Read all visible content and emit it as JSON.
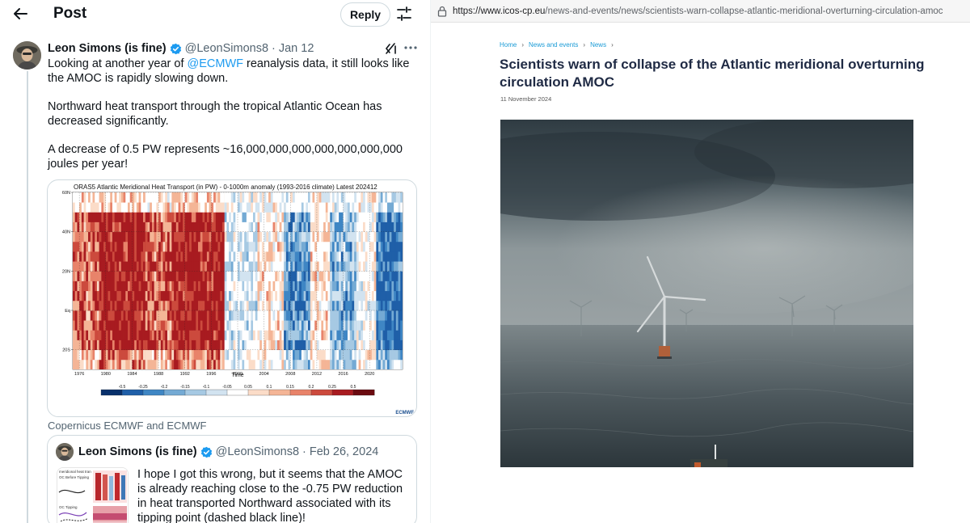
{
  "x_post": {
    "header": {
      "back_icon": "arrow-left-icon",
      "title": "Post",
      "reply_label": "Reply",
      "filter_icon": "sliders-icon"
    },
    "author": {
      "name": "Leon Simons (is fine)",
      "handle": "@LeonSimons8",
      "separator": "·",
      "date": "Jan 12"
    },
    "text": {
      "p1_before": "Looking at another year of ",
      "p1_mention": "@ECMWF",
      "p1_after": " reanalysis data, it still looks like the AMOC is rapidly slowing down.",
      "p2": "Northward heat transport through the tropical Atlantic Ocean has decreased significantly.",
      "p3": "A decrease of 0.5 PW represents ~16,000,000,000,000,000,000,000 joules per year!"
    },
    "attribution": "Copernicus ECMWF and ECMWF",
    "quote": {
      "name": "Leon Simons (is fine)",
      "handle": "@LeonSimons8",
      "separator": "·",
      "date": "Feb 26, 2024",
      "text": "I hope I got this wrong, but it seems that the AMOC is already reaching close to the -0.75 PW reduction in heat transported Northward associated with its tipping point (dashed black line)!",
      "thumb_labels": [
        "meridional heat tran",
        "OC Before Tipping",
        "OC Tipping"
      ]
    }
  },
  "chart_data": {
    "type": "heatmap",
    "title": "ORAS5 Atlantic Meridional Heat Transport (in PW) - 0-1000m anomaly (1993-2016 climate) Latest 202412",
    "xlabel": "Time",
    "ylabel": "",
    "x_ticks": [
      "1976",
      "1980",
      "1984",
      "1988",
      "1992",
      "1996",
      "2000",
      "2004",
      "2008",
      "2012",
      "2016",
      "2020"
    ],
    "y_ticks": [
      "60N",
      "40N",
      "20N",
      "Eq",
      "20S"
    ],
    "xlim": [
      1975,
      2025
    ],
    "ylim": [
      -30,
      60
    ],
    "colorbar_ticks": [
      "-0.5",
      "-0.25",
      "-0.2",
      "-0.15",
      "-0.1",
      "-0.05",
      "0.05",
      "0.1",
      "0.15",
      "0.2",
      "0.25",
      "0.5"
    ],
    "colorbar_colors": [
      "#08306b",
      "#1f5fa8",
      "#3f86c4",
      "#74aad4",
      "#a6c9e3",
      "#d2e3f0",
      "#ffffff",
      "#fbdcc8",
      "#f4b596",
      "#e8836a",
      "#cc4a3d",
      "#a81b20",
      "#6b0b10"
    ],
    "footer": "ECMWF",
    "periods": [
      {
        "from": 1975,
        "to": 1979,
        "value": 0.2
      },
      {
        "from": 1979,
        "to": 1986,
        "value": 0.3
      },
      {
        "from": 1986,
        "to": 1990,
        "value": 0.2
      },
      {
        "from": 1990,
        "to": 1998,
        "value": 0.3
      },
      {
        "from": 1998,
        "to": 2003,
        "value": -0.05
      },
      {
        "from": 2003,
        "to": 2007,
        "value": 0.05
      },
      {
        "from": 2007,
        "to": 2011,
        "value": -0.2
      },
      {
        "from": 2011,
        "to": 2014,
        "value": 0.05
      },
      {
        "from": 2014,
        "to": 2018,
        "value": -0.15
      },
      {
        "from": 2018,
        "to": 2021,
        "value": 0.0
      },
      {
        "from": 2021,
        "to": 2025,
        "value": -0.25
      }
    ]
  },
  "browser": {
    "url_host": "https://www.icos-cp.eu",
    "url_path": "/news-and-events/news/scientists-warn-collapse-atlantic-meridional-overturning-circulation-amoc",
    "lock_icon": "lock-icon"
  },
  "article": {
    "breadcrumb": [
      {
        "label": "Home"
      },
      {
        "label": "News and events"
      },
      {
        "label": "News"
      }
    ],
    "breadcrumb_sep": "›",
    "title": "Scientists warn of collapse of the Atlantic meridional overturning circulation AMOC",
    "date": "11 November 2024",
    "image": "offshore-wind-turbines-photo"
  }
}
